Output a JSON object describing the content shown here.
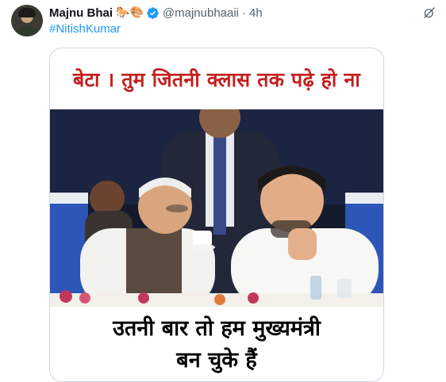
{
  "tweet": {
    "author_name": "Majnu Bhai",
    "author_emoji": "🐎🎨",
    "handle": "@majnubhaaii",
    "separator": "·",
    "time": "4h",
    "hashtag": "#NitishKumar"
  },
  "media": {
    "caption_top": "बेटा । तुम जितनी क्लास तक पढ़े हो ना",
    "caption_bottom_line1": "उतनी बार तो हम मुख्यमंत्री",
    "caption_bottom_line2": "बन चुके हैं"
  },
  "icons": {
    "verified": "verified-badge-icon",
    "grok": "grok-icon"
  },
  "colors": {
    "verified": "#1d9bf0",
    "link": "#1d9bf0",
    "caption_top": "#c41e1e",
    "secondary_text": "#536471"
  }
}
